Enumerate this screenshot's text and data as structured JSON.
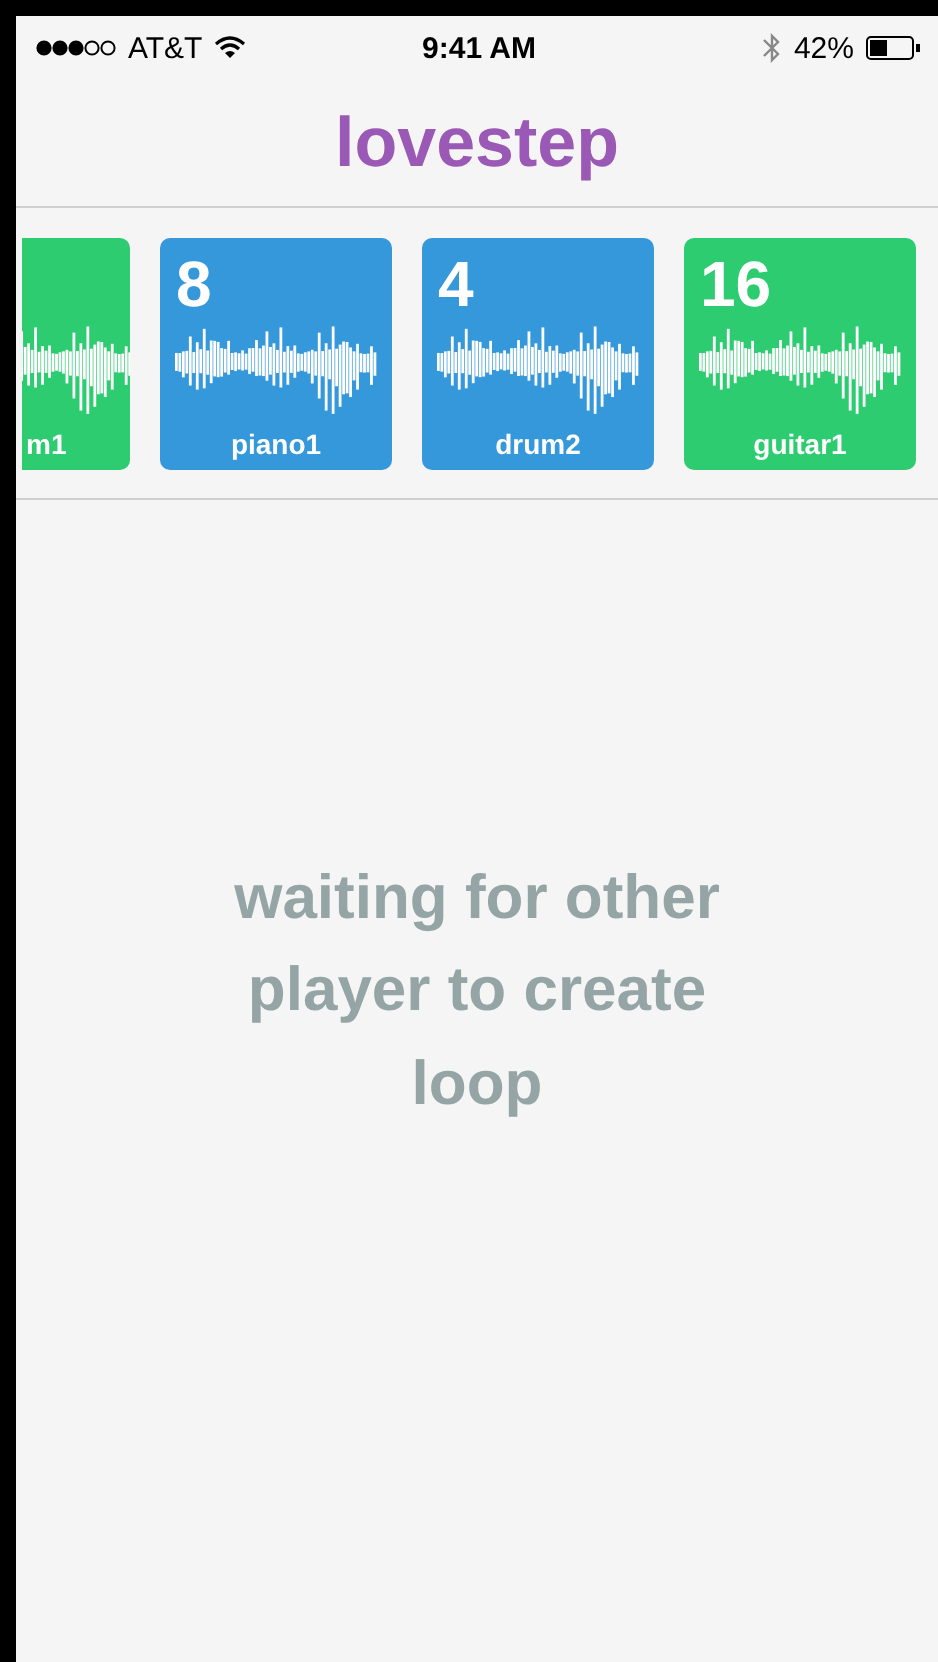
{
  "status_bar": {
    "carrier": "AT&T",
    "time": "9:41 AM",
    "battery": "42%"
  },
  "title": "lovestep",
  "loops": [
    {
      "kind": "cut",
      "label": "m1",
      "color": "#2ecc71"
    },
    {
      "kind": "full",
      "count": "8",
      "label": "piano1",
      "color": "#3498db"
    },
    {
      "kind": "full",
      "count": "4",
      "label": "drum2",
      "color": "#3498db"
    },
    {
      "kind": "full",
      "count": "16",
      "label": "guitar1",
      "color": "#2ecc71"
    }
  ],
  "message": "waiting for other player to create loop"
}
